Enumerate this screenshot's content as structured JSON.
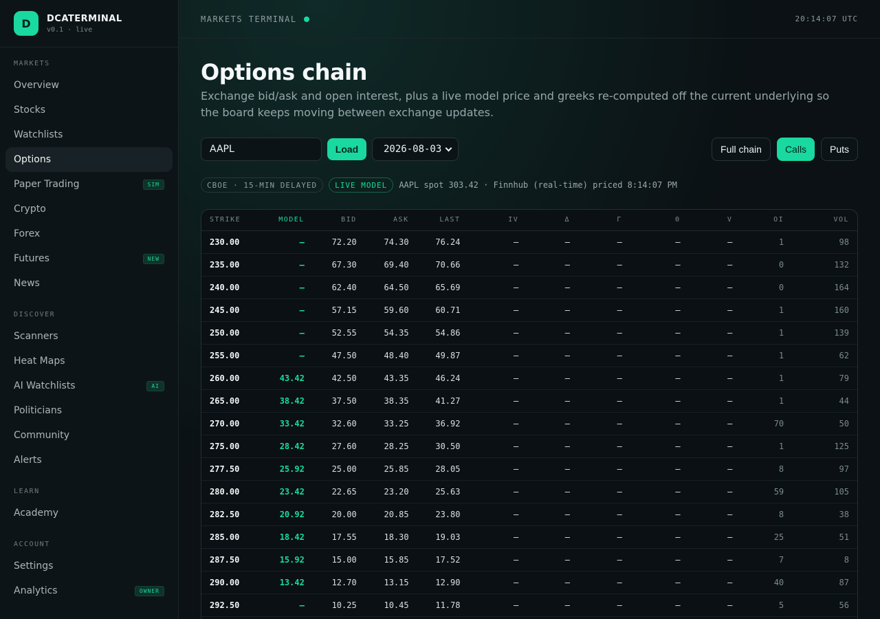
{
  "brand": {
    "logo_letter": "D",
    "name": "DCATERMINAL",
    "sub": "v0.1 · live"
  },
  "sidebar": {
    "sections": [
      {
        "label": "MARKETS",
        "items": [
          {
            "label": "Overview"
          },
          {
            "label": "Stocks"
          },
          {
            "label": "Watchlists"
          },
          {
            "label": "Options",
            "active": true
          },
          {
            "label": "Paper Trading",
            "badge": "SIM"
          },
          {
            "label": "Crypto"
          },
          {
            "label": "Forex"
          },
          {
            "label": "Futures",
            "badge": "NEW"
          },
          {
            "label": "News"
          }
        ]
      },
      {
        "label": "DISCOVER",
        "items": [
          {
            "label": "Scanners"
          },
          {
            "label": "Heat Maps"
          },
          {
            "label": "AI Watchlists",
            "badge": "AI"
          },
          {
            "label": "Politicians"
          },
          {
            "label": "Community"
          },
          {
            "label": "Alerts"
          }
        ]
      },
      {
        "label": "LEARN",
        "items": [
          {
            "label": "Academy"
          }
        ]
      },
      {
        "label": "ACCOUNT",
        "items": [
          {
            "label": "Settings"
          },
          {
            "label": "Analytics",
            "badge": "OWNER"
          }
        ]
      }
    ]
  },
  "topbar": {
    "title": "MARKETS TERMINAL",
    "clock": "20:14:07 UTC"
  },
  "page": {
    "title": "Options chain",
    "description": "Exchange bid/ask and open interest, plus a live model price and greeks re-computed off the current underlying so the board keeps moving between exchange updates."
  },
  "controls": {
    "ticker_value": "AAPL",
    "load_label": "Load",
    "expiry_value": "2026-08-03",
    "full_chain_label": "Full chain",
    "calls_label": "Calls",
    "puts_label": "Puts"
  },
  "status": {
    "source_pill": "CBOE · 15-MIN DELAYED",
    "model_pill": "LIVE MODEL",
    "text": "AAPL spot 303.42 · Finnhub (real-time) priced 8:14:07 PM"
  },
  "table": {
    "headers": [
      "STRIKE",
      "MODEL",
      "BID",
      "ASK",
      "LAST",
      "IV",
      "Δ",
      "Γ",
      "Θ",
      "V",
      "OI",
      "VOL"
    ],
    "rows": [
      [
        "230.00",
        "—",
        "72.20",
        "74.30",
        "76.24",
        "—",
        "—",
        "—",
        "—",
        "—",
        "1",
        "98"
      ],
      [
        "235.00",
        "—",
        "67.30",
        "69.40",
        "70.66",
        "—",
        "—",
        "—",
        "—",
        "—",
        "0",
        "132"
      ],
      [
        "240.00",
        "—",
        "62.40",
        "64.50",
        "65.69",
        "—",
        "—",
        "—",
        "—",
        "—",
        "0",
        "164"
      ],
      [
        "245.00",
        "—",
        "57.15",
        "59.60",
        "60.71",
        "—",
        "—",
        "—",
        "—",
        "—",
        "1",
        "160"
      ],
      [
        "250.00",
        "—",
        "52.55",
        "54.35",
        "54.86",
        "—",
        "—",
        "—",
        "—",
        "—",
        "1",
        "139"
      ],
      [
        "255.00",
        "—",
        "47.50",
        "48.40",
        "49.87",
        "—",
        "—",
        "—",
        "—",
        "—",
        "1",
        "62"
      ],
      [
        "260.00",
        "43.42",
        "42.50",
        "43.35",
        "46.24",
        "—",
        "—",
        "—",
        "—",
        "—",
        "1",
        "79"
      ],
      [
        "265.00",
        "38.42",
        "37.50",
        "38.35",
        "41.27",
        "—",
        "—",
        "—",
        "—",
        "—",
        "1",
        "44"
      ],
      [
        "270.00",
        "33.42",
        "32.60",
        "33.25",
        "36.92",
        "—",
        "—",
        "—",
        "—",
        "—",
        "70",
        "50"
      ],
      [
        "275.00",
        "28.42",
        "27.60",
        "28.25",
        "30.50",
        "—",
        "—",
        "—",
        "—",
        "—",
        "1",
        "125"
      ],
      [
        "277.50",
        "25.92",
        "25.00",
        "25.85",
        "28.05",
        "—",
        "—",
        "—",
        "—",
        "—",
        "8",
        "97"
      ],
      [
        "280.00",
        "23.42",
        "22.65",
        "23.20",
        "25.63",
        "—",
        "—",
        "—",
        "—",
        "—",
        "59",
        "105"
      ],
      [
        "282.50",
        "20.92",
        "20.00",
        "20.85",
        "23.80",
        "—",
        "—",
        "—",
        "—",
        "—",
        "8",
        "38"
      ],
      [
        "285.00",
        "18.42",
        "17.55",
        "18.30",
        "19.03",
        "—",
        "—",
        "—",
        "—",
        "—",
        "25",
        "51"
      ],
      [
        "287.50",
        "15.92",
        "15.00",
        "15.85",
        "17.52",
        "—",
        "—",
        "—",
        "—",
        "—",
        "7",
        "8"
      ],
      [
        "290.00",
        "13.42",
        "12.70",
        "13.15",
        "12.90",
        "—",
        "—",
        "—",
        "—",
        "—",
        "40",
        "87"
      ],
      [
        "292.50",
        "—",
        "10.25",
        "10.45",
        "11.78",
        "—",
        "—",
        "—",
        "—",
        "—",
        "5",
        "56"
      ]
    ]
  },
  "colors": {
    "accent": "#19d9a0",
    "background": "#0b1114",
    "sidebar": "#0d1417"
  }
}
